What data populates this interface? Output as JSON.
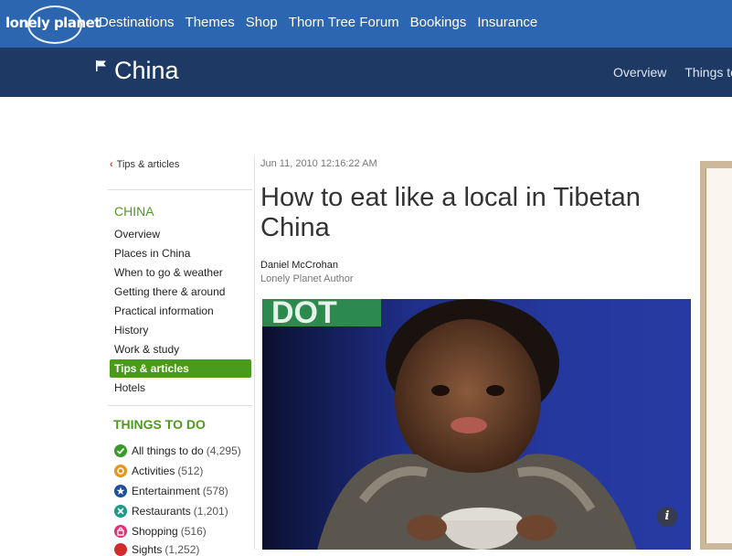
{
  "site": {
    "logo_text": "lonely planet"
  },
  "topnav": [
    "Destinations",
    "Themes",
    "Shop",
    "Thorn Tree Forum",
    "Bookings",
    "Insurance"
  ],
  "subheader": {
    "country": "China",
    "nav": [
      "Overview",
      "Things to"
    ]
  },
  "sidebar": {
    "back_label": "Tips & articles",
    "section_title": "CHINA",
    "links": [
      "Overview",
      "Places in China",
      "When to go & weather",
      "Getting there & around",
      "Practical information",
      "History",
      "Work & study"
    ],
    "active": "Tips & articles",
    "after_active": "Hotels",
    "things_title": "THINGS TO DO",
    "things": [
      {
        "label": "All things to do",
        "count": "(4,295)",
        "icon": "check-icon",
        "color": "#3a9a2a"
      },
      {
        "label": "Activities",
        "count": "(512)",
        "icon": "activities-icon",
        "color": "#e6941e"
      },
      {
        "label": "Entertainment",
        "count": "(578)",
        "icon": "star-icon",
        "color": "#1e4f9a"
      },
      {
        "label": "Restaurants",
        "count": "(1,201)",
        "icon": "restaurant-icon",
        "color": "#1f9a88"
      },
      {
        "label": "Shopping",
        "count": "(516)",
        "icon": "shopping-bag-icon",
        "color": "#e0337a"
      },
      {
        "label": "Sights",
        "count": "(1,252)",
        "icon": "sights-icon",
        "color": "#d02c2c"
      }
    ]
  },
  "article": {
    "date": "Jun 11, 2010 12:16:22 AM",
    "title": "How to eat like a local in Tibetan China",
    "author": "Daniel McCrohan",
    "author_role": "Lonely Planet Author",
    "photo_info": "i"
  }
}
